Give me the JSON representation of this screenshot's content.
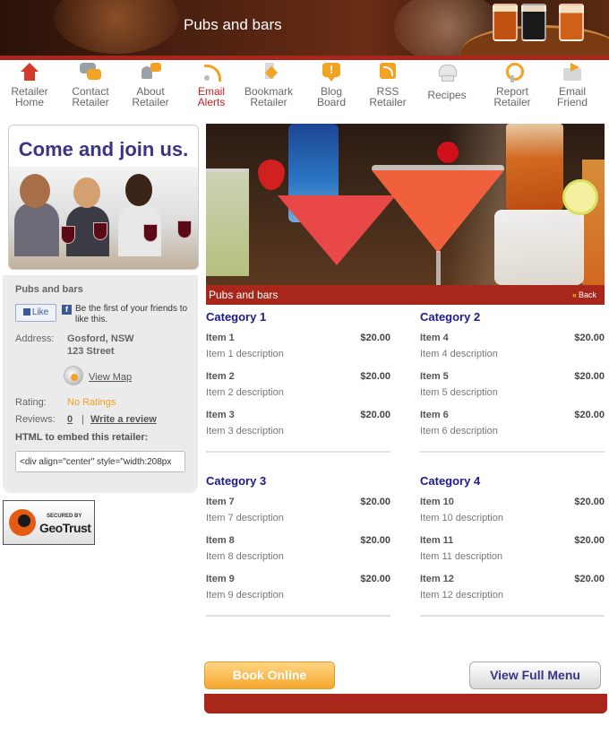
{
  "header": {
    "title": "Pubs and bars"
  },
  "nav": [
    {
      "line1": "Retailer",
      "line2": "Home",
      "icon": "home-icon",
      "active": false
    },
    {
      "line1": "Contact",
      "line2": "Retailer",
      "icon": "contact-icon",
      "active": false
    },
    {
      "line1": "About",
      "line2": "Retailer",
      "icon": "about-icon",
      "active": false
    },
    {
      "line1": "Email",
      "line2": "Alerts",
      "icon": "email-alerts-icon",
      "active": true
    },
    {
      "line1": "Bookmark",
      "line2": "Retailer",
      "icon": "bookmark-icon",
      "active": false
    },
    {
      "line1": "Blog",
      "line2": "Board",
      "icon": "blog-icon",
      "active": false
    },
    {
      "line1": "RSS",
      "line2": "Retailer",
      "icon": "rss-icon",
      "active": false
    },
    {
      "line1": "Recipes",
      "line2": "",
      "icon": "recipes-icon",
      "active": false
    },
    {
      "line1": "Report",
      "line2": "Retailer",
      "icon": "report-icon",
      "active": false
    },
    {
      "line1": "Email",
      "line2": "Friend",
      "icon": "email-friend-icon",
      "active": false
    }
  ],
  "sidebar": {
    "promo_title": "Come and join us.",
    "business_name": "Pubs and bars",
    "like_label": "Like",
    "fb_text": "Be the first of your friends to like this.",
    "address_label": "Address:",
    "address_line1": "Gosford, NSW",
    "address_line2": "123 Street",
    "view_map": "View Map",
    "rating_label": "Rating:",
    "rating_value": "No Ratings",
    "reviews_label": "Reviews:",
    "reviews_count": "0",
    "reviews_sep": "|",
    "write_review": "Write a review",
    "embed_label": "HTML to embed this retailer:",
    "embed_value": "<div align=\"center\" style=\"width:208px"
  },
  "geotrust": {
    "secured": "SECURED BY",
    "name": "GeoTrust"
  },
  "main": {
    "hero_title": "Pubs and bars",
    "back_label": "Back",
    "categories": [
      {
        "title": "Category 1",
        "items": [
          {
            "name": "Item 1",
            "price": "$20.00",
            "desc": "Item 1 description"
          },
          {
            "name": "Item 2",
            "price": "$20.00",
            "desc": "Item 2 description"
          },
          {
            "name": "Item 3",
            "price": "$20.00",
            "desc": "Item 3 description"
          }
        ]
      },
      {
        "title": "Category 2",
        "items": [
          {
            "name": "Item 4",
            "price": "$20.00",
            "desc": "Item 4 description"
          },
          {
            "name": "Item 5",
            "price": "$20.00",
            "desc": "Item 5 description"
          },
          {
            "name": "Item 6",
            "price": "$20.00",
            "desc": "Item 6 description"
          }
        ]
      },
      {
        "title": "Category 3",
        "items": [
          {
            "name": "Item 7",
            "price": "$20.00",
            "desc": "Item 7 description"
          },
          {
            "name": "Item 8",
            "price": "$20.00",
            "desc": "Item 8 description"
          },
          {
            "name": "Item 9",
            "price": "$20.00",
            "desc": "Item 9 description"
          }
        ]
      },
      {
        "title": "Category 4",
        "items": [
          {
            "name": "Item 10",
            "price": "$20.00",
            "desc": "Item 10 description"
          },
          {
            "name": "Item 11",
            "price": "$20.00",
            "desc": "Item 11 description"
          },
          {
            "name": "Item 12",
            "price": "$20.00",
            "desc": "Item 12 description"
          }
        ]
      }
    ],
    "book_online": "Book Online",
    "view_full_menu": "View Full Menu"
  },
  "colors": {
    "brand_red": "#a8271a",
    "link_blue": "#1a1a8a",
    "accent_orange": "#f6a62e",
    "active_nav": "#d01c1c",
    "rating": "#f0a020"
  }
}
